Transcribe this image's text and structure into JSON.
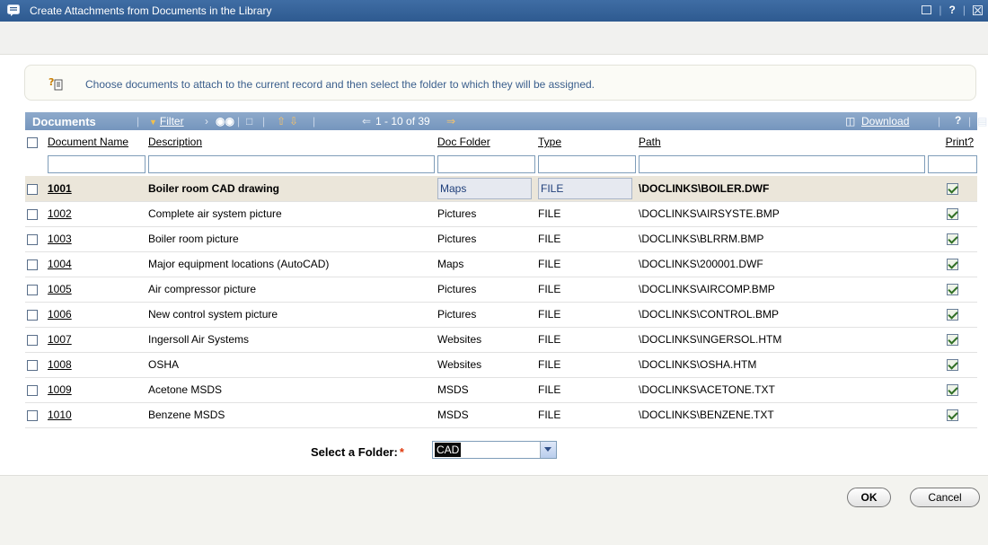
{
  "window": {
    "title": "Create Attachments from Documents in the Library",
    "controls": {
      "help": "?",
      "separator": "|"
    }
  },
  "info": {
    "message": "Choose documents to attach to the current record and then select the folder to which they will be assigned."
  },
  "grid": {
    "title": "Documents",
    "filter_label": "Filter",
    "pager": "1 - 10 of 39",
    "download_label": "Download",
    "help_label": "?",
    "columns": [
      "Document Name",
      "Description",
      "Doc Folder",
      "Type",
      "Path",
      "Print?"
    ],
    "rows": [
      {
        "id": "1001",
        "description": "Boiler room CAD drawing",
        "folder": "Maps",
        "type": "FILE",
        "path": "\\DOCLINKS\\BOILER.DWF",
        "selected": true
      },
      {
        "id": "1002",
        "description": "Complete air system picture",
        "folder": "Pictures",
        "type": "FILE",
        "path": "\\DOCLINKS\\AIRSYSTE.BMP"
      },
      {
        "id": "1003",
        "description": "Boiler room picture",
        "folder": "Pictures",
        "type": "FILE",
        "path": "\\DOCLINKS\\BLRRM.BMP"
      },
      {
        "id": "1004",
        "description": "Major equipment locations (AutoCAD)",
        "folder": "Maps",
        "type": "FILE",
        "path": "\\DOCLINKS\\200001.DWF"
      },
      {
        "id": "1005",
        "description": "Air compressor picture",
        "folder": "Pictures",
        "type": "FILE",
        "path": "\\DOCLINKS\\AIRCOMP.BMP"
      },
      {
        "id": "1006",
        "description": "New control system picture",
        "folder": "Pictures",
        "type": "FILE",
        "path": "\\DOCLINKS\\CONTROL.BMP"
      },
      {
        "id": "1007",
        "description": "Ingersoll Air Systems",
        "folder": "Websites",
        "type": "FILE",
        "path": "\\DOCLINKS\\INGERSOL.HTM"
      },
      {
        "id": "1008",
        "description": "OSHA",
        "folder": "Websites",
        "type": "FILE",
        "path": "\\DOCLINKS\\OSHA.HTM"
      },
      {
        "id": "1009",
        "description": "Acetone MSDS",
        "folder": "MSDS",
        "type": "FILE",
        "path": "\\DOCLINKS\\ACETONE.TXT"
      },
      {
        "id": "1010",
        "description": "Benzene MSDS",
        "folder": "MSDS",
        "type": "FILE",
        "path": "\\DOCLINKS\\BENZENE.TXT"
      }
    ]
  },
  "folder_select": {
    "label": "Select a Folder:",
    "required_mark": "*",
    "value": "CAD"
  },
  "buttons": {
    "ok": "OK",
    "cancel": "Cancel"
  },
  "colors": {
    "titlebar": "#2e5a90",
    "gridbar": "#7f9dc3",
    "info_text": "#3a5e8c",
    "required": "#e0380b"
  }
}
